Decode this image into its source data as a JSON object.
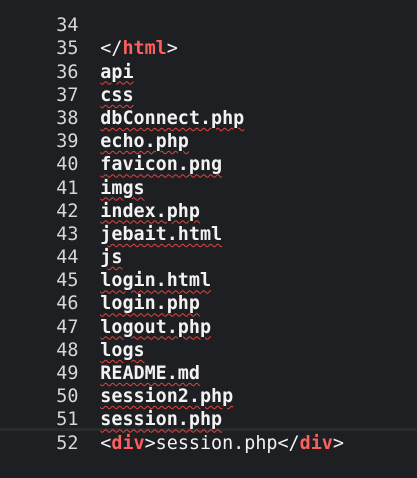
{
  "editor": {
    "top_partial": {
      "number": "34",
      "text": ""
    },
    "lines": [
      {
        "number": "35",
        "kind": "tag",
        "open": "</",
        "tag": "html",
        "close": ">"
      },
      {
        "number": "36",
        "kind": "text",
        "text": "api"
      },
      {
        "number": "37",
        "kind": "text",
        "text": "css"
      },
      {
        "number": "38",
        "kind": "text",
        "text": "dbConnect.php"
      },
      {
        "number": "39",
        "kind": "text",
        "text": "echo.php"
      },
      {
        "number": "40",
        "kind": "text",
        "text": "favicon.png"
      },
      {
        "number": "41",
        "kind": "text",
        "text": "imgs"
      },
      {
        "number": "42",
        "kind": "text",
        "text": "index.php"
      },
      {
        "number": "43",
        "kind": "text",
        "text": "jebait.html"
      },
      {
        "number": "44",
        "kind": "text",
        "text": "js"
      },
      {
        "number": "45",
        "kind": "text",
        "text": "login.html"
      },
      {
        "number": "46",
        "kind": "text",
        "text": "login.php"
      },
      {
        "number": "47",
        "kind": "text",
        "text": "logout.php"
      },
      {
        "number": "48",
        "kind": "text",
        "text": "logs"
      },
      {
        "number": "49",
        "kind": "text",
        "text": "README.md"
      },
      {
        "number": "50",
        "kind": "text",
        "text": "session2.php"
      },
      {
        "number": "51",
        "kind": "text",
        "text": "session.php"
      },
      {
        "number": "52",
        "kind": "element",
        "open_tag": "div",
        "inner": "session.php",
        "close_tag": "div"
      }
    ]
  },
  "colors": {
    "background": "#1e1f22",
    "tag": "#ff5e5e",
    "text": "#f2f2f2",
    "squiggle": "#e0443e"
  }
}
